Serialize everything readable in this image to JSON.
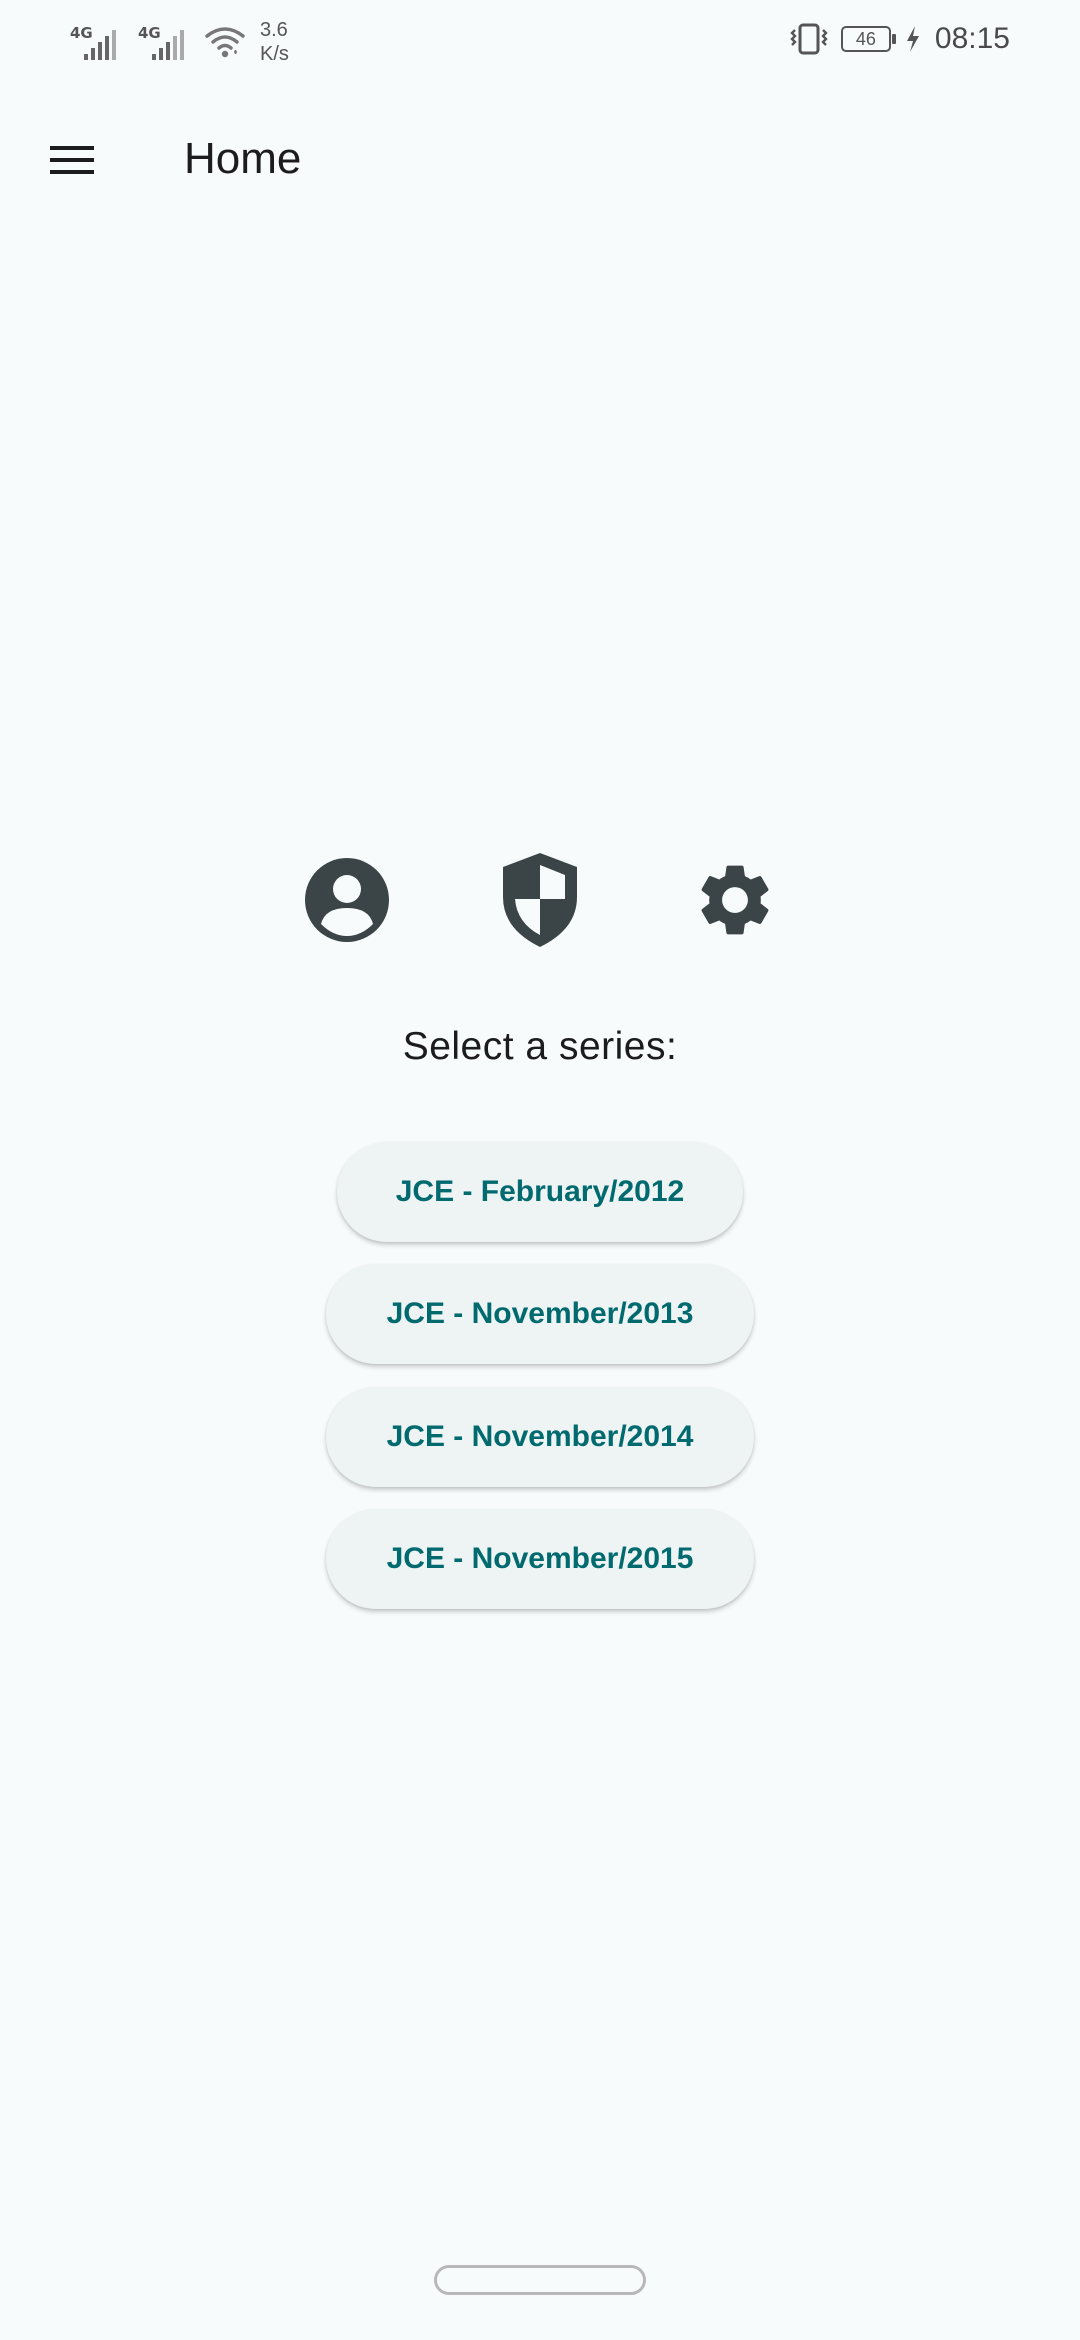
{
  "status_bar": {
    "signal_1_label": "4G",
    "signal_2_label": "4G",
    "speed_value": "3.6",
    "speed_unit": "K/s",
    "battery_level": "46",
    "time": "08:15"
  },
  "app_bar": {
    "title": "Home",
    "menu_icon": "hamburger-menu-icon"
  },
  "icons": [
    {
      "name": "account-circle-icon"
    },
    {
      "name": "security-shield-icon"
    },
    {
      "name": "settings-gear-icon"
    }
  ],
  "prompt": "Select a series:",
  "series": [
    {
      "label": "JCE - February/2012"
    },
    {
      "label": "JCE - November/2013"
    },
    {
      "label": "JCE - November/2014"
    },
    {
      "label": "JCE - November/2015"
    }
  ],
  "colors": {
    "background": "#f8fbfc",
    "button_bg": "#eef3f4",
    "button_text": "#006a6f",
    "icon": "#3b4548"
  }
}
